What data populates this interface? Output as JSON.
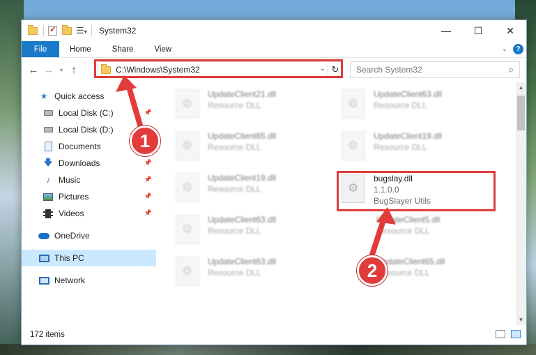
{
  "window": {
    "title": "System32",
    "controls": {
      "minimize": "—",
      "maximize": "☐",
      "close": "✕"
    }
  },
  "ribbon": {
    "tabs": [
      {
        "label": "File"
      },
      {
        "label": "Home"
      },
      {
        "label": "Share"
      },
      {
        "label": "View"
      }
    ]
  },
  "navigation": {
    "address_path": "C:\\Windows\\System32",
    "search_placeholder": "Search System32"
  },
  "nav_pane": {
    "items": [
      {
        "label": "Quick access"
      },
      {
        "label": "Local Disk (C:)",
        "pinned": true
      },
      {
        "label": "Local Disk (D:)"
      },
      {
        "label": "Documents",
        "pinned": true
      },
      {
        "label": "Downloads",
        "pinned": true
      },
      {
        "label": "Music",
        "pinned": true
      },
      {
        "label": "Pictures",
        "pinned": true
      },
      {
        "label": "Videos",
        "pinned": true
      },
      {
        "label": "OneDrive"
      },
      {
        "label": "This PC",
        "selected": true
      },
      {
        "label": "Network"
      }
    ]
  },
  "files": [
    {
      "name": "UpdateClient21.dll",
      "meta1": "Resource DLL",
      "meta2": ""
    },
    {
      "name": "UpdateClient63.dll",
      "meta1": "Resource DLL",
      "meta2": ""
    },
    {
      "name": "UpdateClient65.dll",
      "meta1": "Resource DLL",
      "meta2": ""
    },
    {
      "name": "UpdateClient19.dll",
      "meta1": "Resource DLL",
      "meta2": ""
    },
    {
      "name": "UpdateClient19.dll",
      "meta1": "Resource DLL",
      "meta2": ""
    },
    {
      "name": "bugslay.dll",
      "meta1": "1.1.0.0",
      "meta2": "BugSlayer Utils"
    },
    {
      "name": "UpdateClient63.dll",
      "meta1": "Resource DLL",
      "meta2": ""
    },
    {
      "name": "UpdateClient5.dll",
      "meta1": "Resource DLL",
      "meta2": ""
    },
    {
      "name": "UpdateClient63.dll",
      "meta1": "Resource DLL",
      "meta2": ""
    },
    {
      "name": "UpdateClient65.dll",
      "meta1": "Resource DLL",
      "meta2": ""
    }
  ],
  "status": {
    "item_count": "172 items"
  },
  "callouts": {
    "step1": "1",
    "step2": "2"
  },
  "colors": {
    "accent": "#1979ca",
    "highlight": "#e23b3b",
    "selected_bg": "#cce8ff"
  }
}
